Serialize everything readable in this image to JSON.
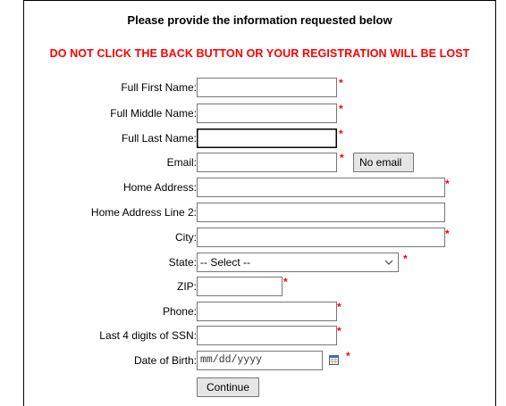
{
  "header": {
    "title": "Please provide the information requested below",
    "warning": "DO NOT CLICK THE BACK BUTTON OR YOUR REGISTRATION WILL BE LOST"
  },
  "form": {
    "required_marker": "*",
    "fields": {
      "first_name": {
        "label": "Full First Name:",
        "value": ""
      },
      "middle_name": {
        "label": "Full Middle Name:",
        "value": ""
      },
      "last_name": {
        "label": "Full Last Name:",
        "value": ""
      },
      "email": {
        "label": "Email:",
        "value": "",
        "no_email_button": "No email"
      },
      "home_address": {
        "label": "Home Address:",
        "value": ""
      },
      "home_address_2": {
        "label": "Home Address Line 2:",
        "value": ""
      },
      "city": {
        "label": "City:",
        "value": ""
      },
      "state": {
        "label": "State:",
        "selected": "-- Select --"
      },
      "zip": {
        "label": "ZIP:",
        "value": ""
      },
      "phone": {
        "label": "Phone:",
        "value": ""
      },
      "ssn_last4": {
        "label": "Last 4 digits of SSN:",
        "value": ""
      },
      "dob": {
        "label": "Date of Birth:",
        "placeholder": "mm/dd/yyyy",
        "calendar_icon": "calendar-icon"
      }
    },
    "continue_button": "Continue"
  }
}
